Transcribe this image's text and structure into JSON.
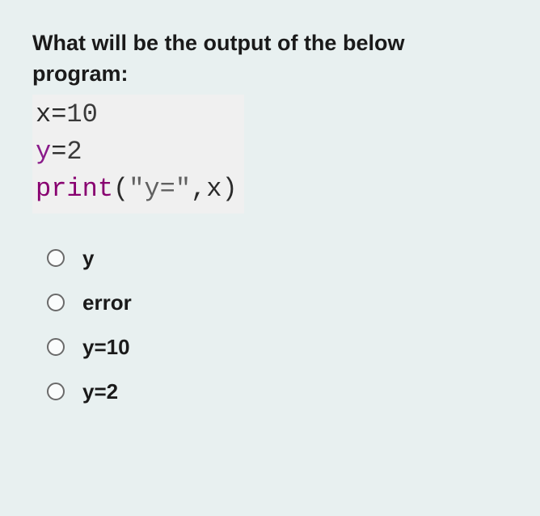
{
  "question": {
    "prompt_line1": "What will be the output of the below",
    "prompt_line2": "program:"
  },
  "code": {
    "line1_var": "x",
    "line1_eq": "=",
    "line1_val": "10",
    "line2_var": "y",
    "line2_eq": "=",
    "line2_val": "2",
    "line3_func": "print",
    "line3_open": "(",
    "line3_str": "\"y=\"",
    "line3_comma": ",",
    "line3_arg": "x",
    "line3_close": ")"
  },
  "options": [
    {
      "label": "y"
    },
    {
      "label": "error"
    },
    {
      "label": "y=10"
    },
    {
      "label": "y=2"
    }
  ]
}
